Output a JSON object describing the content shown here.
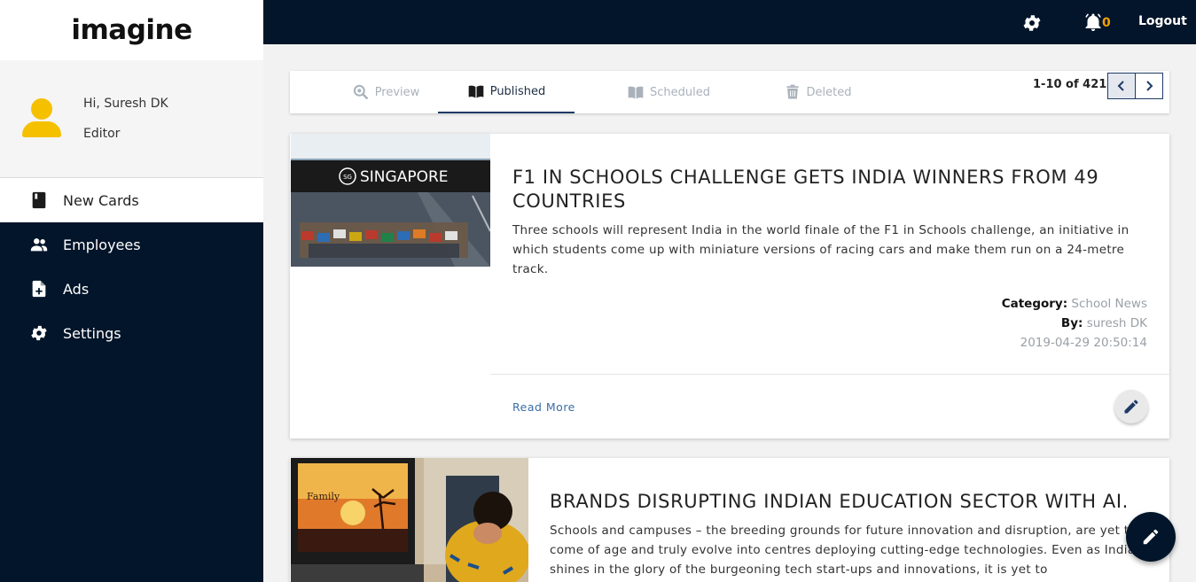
{
  "brand": {
    "logo": "imagine"
  },
  "profile": {
    "greeting": "Hi, Suresh DK",
    "role": "Editor"
  },
  "sidebar": {
    "items": [
      {
        "label": "New Cards",
        "icon": "book-icon",
        "active": true
      },
      {
        "label": "Employees",
        "icon": "people-icon",
        "active": false
      },
      {
        "label": "Ads",
        "icon": "add-document-icon",
        "active": false
      },
      {
        "label": "Settings",
        "icon": "gear-icon",
        "active": false
      }
    ]
  },
  "topbar": {
    "notification_count": "0",
    "logout_label": "Logout"
  },
  "tabs": [
    {
      "label": "Preview",
      "icon": "zoom-icon",
      "active": false
    },
    {
      "label": "Published",
      "icon": "open-book-icon",
      "active": true
    },
    {
      "label": "Scheduled",
      "icon": "book-icon",
      "active": false
    },
    {
      "label": "Deleted",
      "icon": "trash-icon",
      "active": false
    }
  ],
  "pager": {
    "text": "1-10 of 421"
  },
  "cards": [
    {
      "title": "F1 IN SCHOOLS CHALLENGE GETS INDIA WINNERS FROM 49 COUNTRIES",
      "description": "Three schools will represent India in the world finale of the F1 in Schools challenge, an initiative in which students come up with miniature versions of racing cars and make them run on a 24-metre track.",
      "category_label": "Category:",
      "category": "School News",
      "by_label": "By:",
      "author": "suresh DK",
      "timestamp": "2019-04-29 20:50:14",
      "read_more": "Read More",
      "image_text": "SINGAPORE",
      "image_logo_text": "SG"
    },
    {
      "title": "BRANDS DISRUPTING INDIAN EDUCATION SECTOR WITH AI.",
      "description": "Schools and campuses – the breeding grounds for future innovation and disruption, are yet to come of age and truly evolve into centres deploying cutting-edge technologies. Even as India shines in the glory of the burgeoning tech start-ups and innovations, it is yet to",
      "image_text": "Family"
    }
  ],
  "colors": {
    "navy": "#03152a",
    "accent_yellow": "#f5c000",
    "badge_orange": "#f5a000",
    "link_blue": "#3a6ea5"
  }
}
